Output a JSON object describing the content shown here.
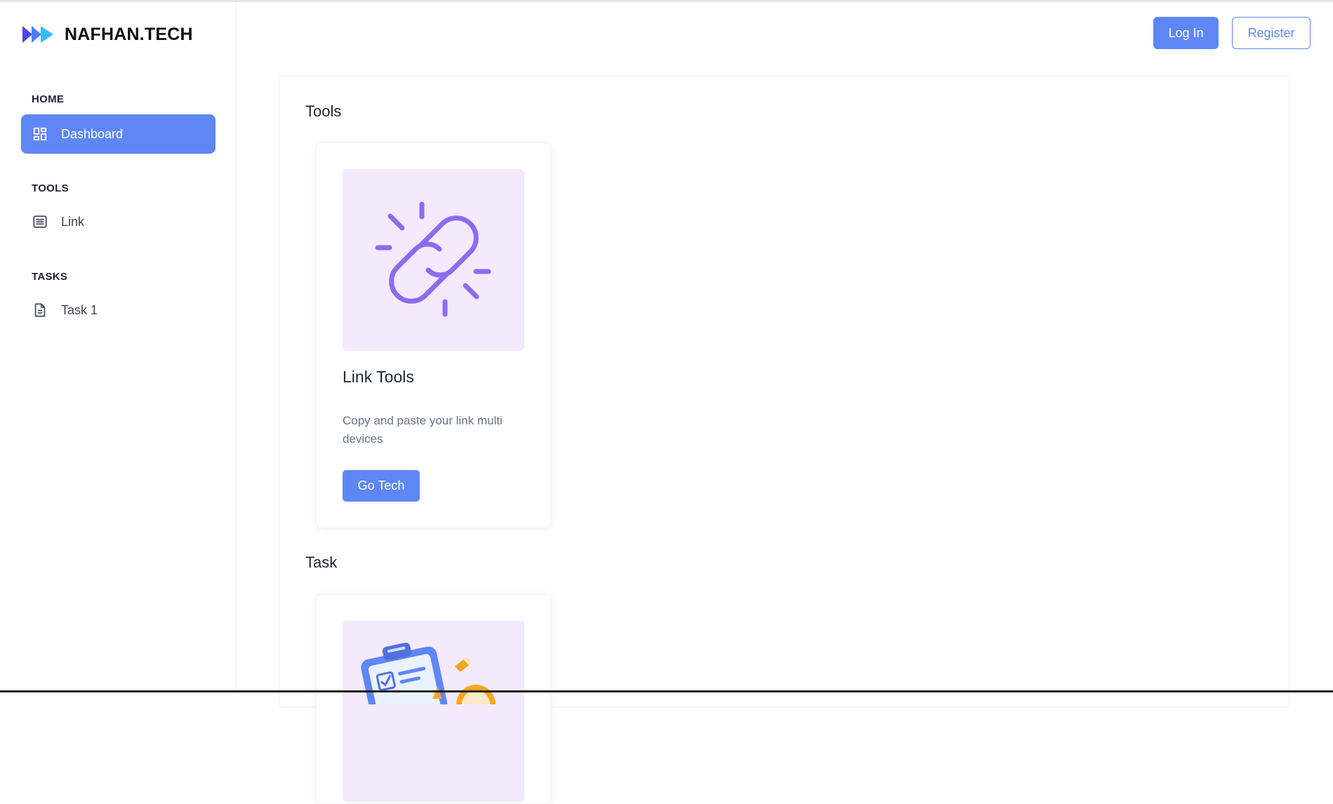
{
  "brand": {
    "name": "NAFHAN.TECH",
    "logo_icon": "double-play-arrow-icon",
    "logo_colors": [
      "#4f46e5",
      "#38bdf8"
    ]
  },
  "sidebar": {
    "sections": [
      {
        "label": "HOME",
        "items": [
          {
            "label": "Dashboard",
            "icon": "dashboard-grid-icon",
            "active": true
          }
        ]
      },
      {
        "label": "TOOLS",
        "items": [
          {
            "label": "Link",
            "icon": "list-icon",
            "active": false
          }
        ]
      },
      {
        "label": "TASKS",
        "items": [
          {
            "label": "Task 1",
            "icon": "document-icon",
            "active": false
          }
        ]
      }
    ]
  },
  "header": {
    "login_label": "Log In",
    "register_label": "Register"
  },
  "main": {
    "tools_section": {
      "title": "Tools",
      "card": {
        "image_icon": "broken-link-icon",
        "title": "Link Tools",
        "description": "Copy and paste your link multi devices",
        "button_label": "Go Tech"
      }
    },
    "task_section": {
      "title": "Task",
      "card": {
        "image_icon": "clipboard-checklist-illustration"
      }
    }
  },
  "colors": {
    "accent": "#5e87f5",
    "card_image_bg": "#f5e9fd",
    "link_icon": "#8b6cf0"
  }
}
